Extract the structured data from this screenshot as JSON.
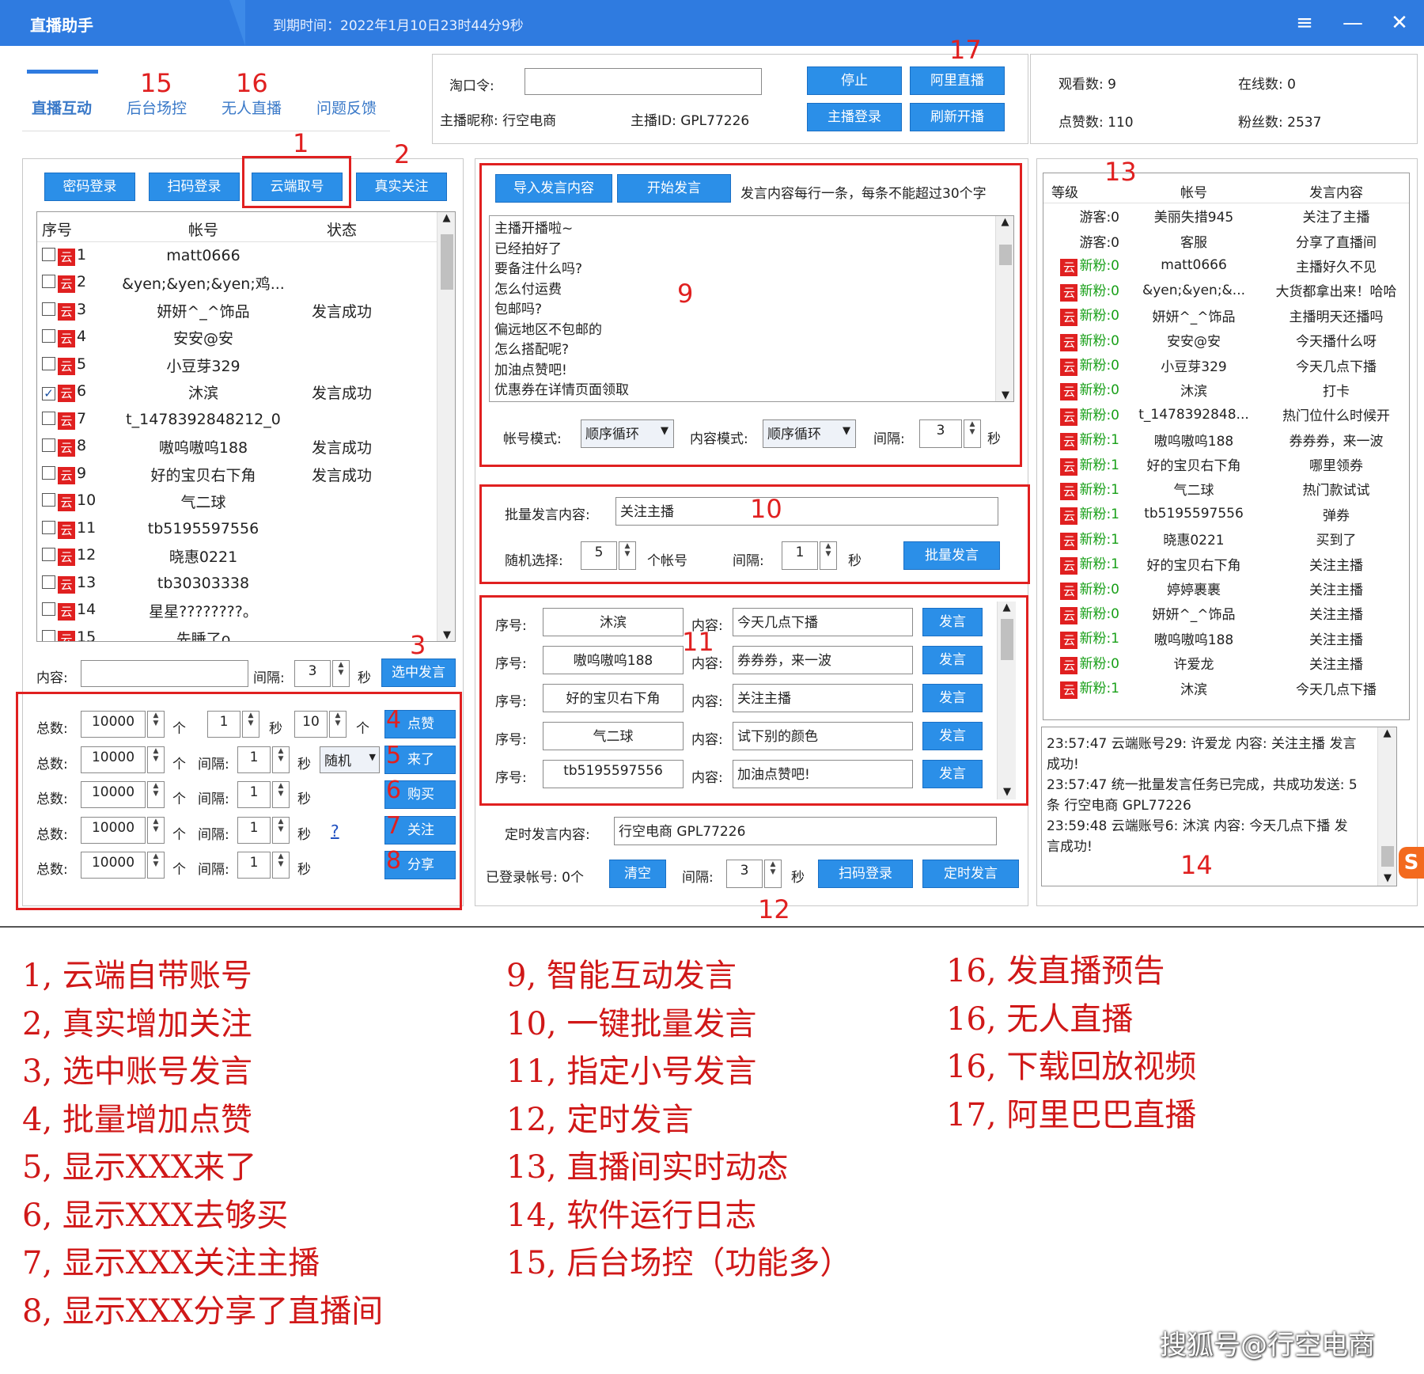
{
  "titlebar": {
    "app": "直播助手",
    "expire": "到期时间：2022年1月10日23时44分9秒"
  },
  "tabs": [
    "直播互动",
    "后台场控",
    "无人直播",
    "问题反馈"
  ],
  "top": {
    "taokouling_label": "淘口令:",
    "nickname": "主播昵称: 行空电商",
    "anchor_id": "主播ID: GPL77226",
    "btn_stop": "停止",
    "btn_ali": "阿里直播",
    "btn_login": "主播登录",
    "btn_refresh": "刷新开播",
    "watch": "观看数: 9",
    "online": "在线数: 0",
    "likes": "点赞数: 110",
    "fans": "粉丝数: 2537"
  },
  "left": {
    "buttons": [
      "密码登录",
      "扫码登录",
      "云端取号",
      "真实关注"
    ],
    "headers": [
      "序号",
      "帐号",
      "状态"
    ],
    "yun": "云",
    "rows": [
      {
        "n": "1",
        "acc": "matt0666",
        "st": "",
        "ck": false
      },
      {
        "n": "2",
        "acc": "&yen;&yen;&yen;鸡...",
        "st": "",
        "ck": false
      },
      {
        "n": "3",
        "acc": "妍妍^_^饰品",
        "st": "发言成功",
        "ck": false
      },
      {
        "n": "4",
        "acc": "安安@安",
        "st": "",
        "ck": false
      },
      {
        "n": "5",
        "acc": "小豆芽329",
        "st": "",
        "ck": false
      },
      {
        "n": "6",
        "acc": "沐滨",
        "st": "发言成功",
        "ck": true
      },
      {
        "n": "7",
        "acc": "t_1478392848212_0",
        "st": "",
        "ck": false
      },
      {
        "n": "8",
        "acc": "嗷呜嗷呜188",
        "st": "发言成功",
        "ck": false
      },
      {
        "n": "9",
        "acc": "好的宝贝右下角",
        "st": "发言成功",
        "ck": false
      },
      {
        "n": "10",
        "acc": "气二球",
        "st": "",
        "ck": false
      },
      {
        "n": "11",
        "acc": "tb5195597556",
        "st": "",
        "ck": false
      },
      {
        "n": "12",
        "acc": "晓惠0221",
        "st": "",
        "ck": false
      },
      {
        "n": "13",
        "acc": "tb30303338",
        "st": "",
        "ck": false
      },
      {
        "n": "14",
        "acc": "星星????????。",
        "st": "",
        "ck": false
      },
      {
        "n": "15",
        "acc": "先睡了o",
        "st": "",
        "ck": false
      }
    ],
    "content_label": "内容:",
    "interval_label": "间隔:",
    "interval_val": "3",
    "sec": "秒",
    "btn_selected": "选中发言"
  },
  "boost": {
    "total_label": "总数:",
    "unit": "个",
    "sec": "秒",
    "interval_label": "间隔:",
    "rows": [
      {
        "total": "10000",
        "a": "1",
        "b": "10",
        "btn": "点赞",
        "num": "4"
      },
      {
        "total": "10000",
        "a": "1",
        "sel": "随机",
        "btn": "来了",
        "num": "5"
      },
      {
        "total": "10000",
        "a": "1",
        "btn": "购买",
        "num": "6"
      },
      {
        "total": "10000",
        "a": "1",
        "q": "?",
        "btn": "关注",
        "num": "7"
      },
      {
        "total": "10000",
        "a": "1",
        "btn": "分享",
        "num": "8"
      }
    ]
  },
  "speech": {
    "btn_import": "导入发言内容",
    "btn_start": "开始发言",
    "hint": "发言内容每行一条，每条不能超过30个字",
    "lines": [
      "主播开播啦~",
      "已经拍好了",
      "要备注什么吗?",
      "怎么付运费",
      "包邮吗?",
      "偏远地区不包邮的",
      "怎么搭配呢?",
      "加油点赞吧!",
      "优惠券在详情页面领取"
    ],
    "acc_mode_label": "帐号模式:",
    "acc_mode": "顺序循环",
    "content_mode_label": "内容模式:",
    "content_mode": "顺序循环",
    "interval_label": "间隔:",
    "interval_val": "3",
    "sec": "秒"
  },
  "batch": {
    "content_label": "批量发言内容:",
    "content": "关注主播",
    "random_label": "随机选择:",
    "random_val": "5",
    "acc_unit": "个帐号",
    "interval_label": "间隔:",
    "interval_val": "1",
    "sec": "秒",
    "btn": "批量发言"
  },
  "assign": {
    "seq_label": "序号:",
    "content_label": "内容:",
    "btn": "发言",
    "rows": [
      {
        "acc": "沐滨",
        "txt": "今天几点下播"
      },
      {
        "acc": "嗷呜嗷呜188",
        "txt": "券券券，来一波"
      },
      {
        "acc": "好的宝贝右下角",
        "txt": "关注主播"
      },
      {
        "acc": "气二球",
        "txt": "试下别的颜色"
      },
      {
        "acc": "tb5195597556",
        "txt": "加油点赞吧!"
      }
    ]
  },
  "timed": {
    "label": "定时发言内容:",
    "content": "行空电商 GPL77226",
    "logged": "已登录帐号: 0个",
    "btn_clear": "清空",
    "interval_label": "间隔:",
    "interval_val": "3",
    "sec": "秒",
    "btn_scan": "扫码登录",
    "btn_timed": "定时发言"
  },
  "feed": {
    "headers": [
      "等级",
      "帐号",
      "发言内容"
    ],
    "rows": [
      {
        "lvl": "游客:0",
        "yun": false,
        "acc": "美丽失措945",
        "msg": "关注了主播"
      },
      {
        "lvl": "游客:0",
        "yun": false,
        "acc": "客服",
        "msg": "分享了直播间"
      },
      {
        "lvl": "新粉:0",
        "yun": true,
        "acc": "matt0666",
        "msg": "主播好久不见"
      },
      {
        "lvl": "新粉:0",
        "yun": true,
        "acc": "&yen;&yen;&...",
        "msg": "大货都拿出来！哈哈"
      },
      {
        "lvl": "新粉:0",
        "yun": true,
        "acc": "妍妍^_^饰品",
        "msg": "主播明天还播吗"
      },
      {
        "lvl": "新粉:0",
        "yun": true,
        "acc": "安安@安",
        "msg": "今天播什么呀"
      },
      {
        "lvl": "新粉:0",
        "yun": true,
        "acc": "小豆芽329",
        "msg": "今天几点下播"
      },
      {
        "lvl": "新粉:0",
        "yun": true,
        "acc": "沐滨",
        "msg": "打卡"
      },
      {
        "lvl": "新粉:0",
        "yun": true,
        "acc": "t_1478392848...",
        "msg": "热门位什么时候开"
      },
      {
        "lvl": "新粉:1",
        "yun": true,
        "acc": "嗷呜嗷呜188",
        "msg": "券券券，来一波"
      },
      {
        "lvl": "新粉:1",
        "yun": true,
        "acc": "好的宝贝右下角",
        "msg": "哪里领券"
      },
      {
        "lvl": "新粉:1",
        "yun": true,
        "acc": "气二球",
        "msg": "热门款试试"
      },
      {
        "lvl": "新粉:1",
        "yun": true,
        "acc": "tb5195597556",
        "msg": "弹券"
      },
      {
        "lvl": "新粉:1",
        "yun": true,
        "acc": "晓惠0221",
        "msg": "买到了"
      },
      {
        "lvl": "新粉:1",
        "yun": true,
        "acc": "好的宝贝右下角",
        "msg": "关注主播"
      },
      {
        "lvl": "新粉:0",
        "yun": true,
        "acc": "婷婷裹裹",
        "msg": "关注主播"
      },
      {
        "lvl": "新粉:0",
        "yun": true,
        "acc": "妍妍^_^饰品",
        "msg": "关注主播"
      },
      {
        "lvl": "新粉:1",
        "yun": true,
        "acc": "嗷呜嗷呜188",
        "msg": "关注主播"
      },
      {
        "lvl": "新粉:0",
        "yun": true,
        "acc": "许爱龙",
        "msg": "关注主播"
      },
      {
        "lvl": "新粉:1",
        "yun": true,
        "acc": "沐滨",
        "msg": "今天几点下播"
      }
    ]
  },
  "log": {
    "lines": [
      "23:57:47 云端账号29: 许爱龙 内容: 关注主播 发言",
      "成功!",
      "23:57:47 统一批量发言任务已完成，共成功发送: 5",
      "条 行空电商 GPL77226",
      "23:59:48 云端账号6: 沐滨 内容: 今天几点下播 发",
      "言成功!"
    ]
  },
  "annotations": {
    "n1": "1",
    "n2": "2",
    "n3": "3",
    "n9": "9",
    "n10": "10",
    "n11": "11",
    "n12": "12",
    "n13": "13",
    "n14": "14",
    "n15": "15",
    "n16": "16",
    "n17": "17"
  },
  "captions": {
    "col1": [
      "1, 云端自带账号",
      "2, 真实增加关注",
      "3, 选中账号发言",
      "4, 批量增加点赞",
      "5, 显示XXX来了",
      "6, 显示XXX去够买",
      "7, 显示XXX关注主播",
      "8, 显示XXX分享了直播间"
    ],
    "col2": [
      "9, 智能互动发言",
      "10, 一键批量发言",
      "11, 指定小号发言",
      "12, 定时发言",
      "13, 直播间实时动态",
      "14, 软件运行日志",
      "15, 后台场控（功能多）"
    ],
    "col3": [
      "16, 发直播预告",
      "16, 无人直播",
      "16, 下载回放视频",
      "17, 阿里巴巴直播"
    ]
  },
  "watermark": "搜狐号@行空电商"
}
